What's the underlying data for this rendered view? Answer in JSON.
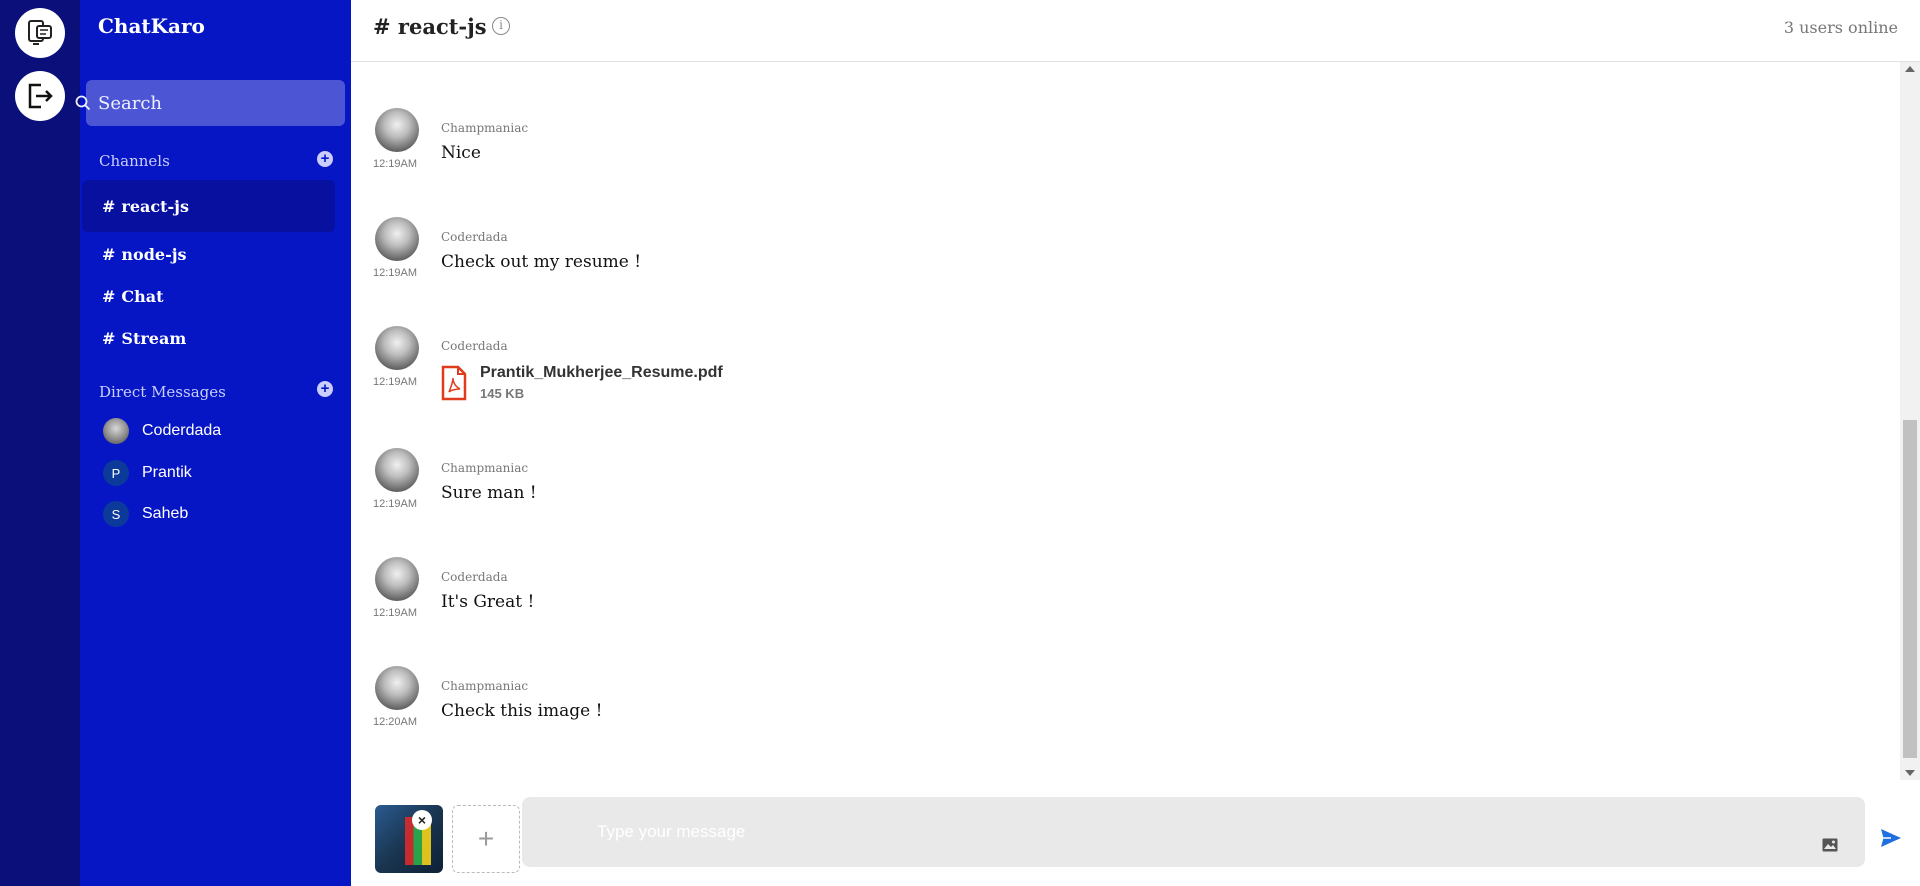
{
  "app": {
    "name": "ChatKaro"
  },
  "sidebar": {
    "search_placeholder": "Search",
    "channels_title": "Channels",
    "channels": [
      {
        "label": "react-js",
        "active": true
      },
      {
        "label": "node-js",
        "active": false
      },
      {
        "label": "Chat",
        "active": false
      },
      {
        "label": "Stream",
        "active": false
      }
    ],
    "dm_title": "Direct Messages",
    "direct_messages": [
      {
        "name": "Coderdada",
        "initial": ""
      },
      {
        "name": "Prantik",
        "initial": "P"
      },
      {
        "name": "Saheb",
        "initial": "S"
      }
    ]
  },
  "header": {
    "channel": "# react-js",
    "online": "3 users online"
  },
  "messages": [
    {
      "author": "Champmaniac",
      "time": "12:19AM",
      "text": "Nice"
    },
    {
      "author": "Coderdada",
      "time": "12:19AM",
      "text": "Check out my resume !"
    },
    {
      "author": "Coderdada",
      "time": "12:19AM",
      "file": {
        "name": "Prantik_Mukherjee_Resume.pdf",
        "size": "145 KB"
      }
    },
    {
      "author": "Champmaniac",
      "time": "12:19AM",
      "text": "Sure man !"
    },
    {
      "author": "Coderdada",
      "time": "12:19AM",
      "text": "It's Great !"
    },
    {
      "author": "Champmaniac",
      "time": "12:20AM",
      "text": "Check this image !"
    }
  ],
  "composer": {
    "placeholder": "Type your message"
  },
  "colors": {
    "rail": "#0b0f7a",
    "sidebar": "#0716c4",
    "active_channel": "#0810a0",
    "send": "#1e6fe0"
  }
}
